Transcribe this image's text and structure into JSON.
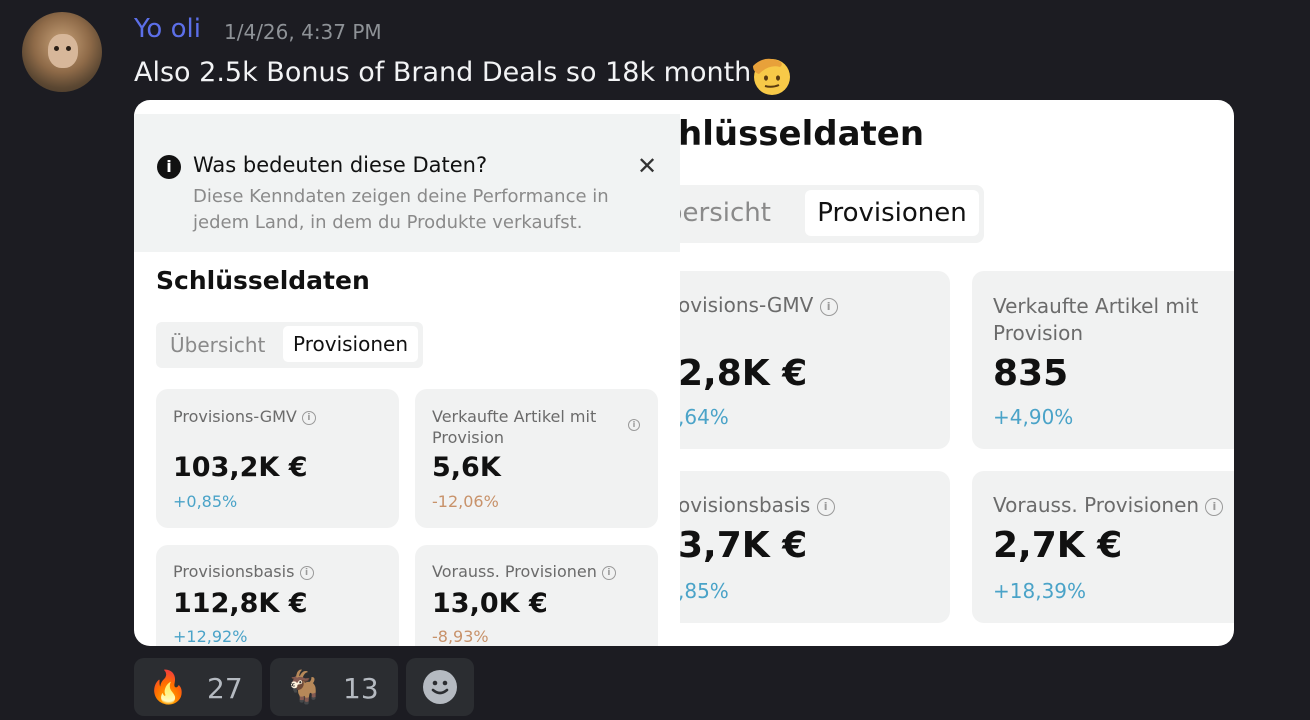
{
  "message": {
    "username": "Yo oli",
    "timestamp": "1/4/26, 4:37 PM",
    "text": "Also 2.5k Bonus of Brand Deals so 18k month",
    "emoji": "saluting-face"
  },
  "screenshot_left": {
    "banner": {
      "title": "Was bedeuten diese Daten?",
      "text": "Diese Kenndaten zeigen deine Performance in jedem Land, in dem du Produkte verkaufst."
    },
    "title": "Schlüsseldaten",
    "tabs": [
      "Übersicht",
      "Provisionen"
    ],
    "active_tab": "Provisionen",
    "cards": [
      {
        "label": "Provisions-GMV",
        "value": "103,2K €",
        "change": "+0,85%"
      },
      {
        "label": "Verkaufte Artikel mit Provision",
        "value": "5,6K",
        "change": "-12,06%"
      },
      {
        "label": "Provisionsbasis",
        "value": "112,8K €",
        "change": "+12,92%"
      },
      {
        "label": "Vorauss. Provisionen",
        "value": "13,0K €",
        "change": "-8,93%"
      }
    ]
  },
  "screenshot_right": {
    "title": "hlüsseldaten",
    "tabs": [
      "bersicht",
      "Provisionen"
    ],
    "cards": [
      {
        "label": "ovisions-GMV",
        "value": "2,8K €",
        "change": ",64%"
      },
      {
        "label": "Verkaufte Artikel mit Provision",
        "value": "835",
        "change": "+4,90%"
      },
      {
        "label": "ovisionsbasis",
        "value": "3,7K €",
        "change": ",85%"
      },
      {
        "label": "Vorauss. Provisionen",
        "value": "2,7K €",
        "change": "+18,39%"
      }
    ]
  },
  "reactions": [
    {
      "emoji": "🔥",
      "count": "27"
    },
    {
      "emoji": "🐐",
      "count": "13"
    }
  ],
  "colors": {
    "positive": "#4aa3c8",
    "negative": "#c8926a",
    "username": "#5c6fe8"
  }
}
